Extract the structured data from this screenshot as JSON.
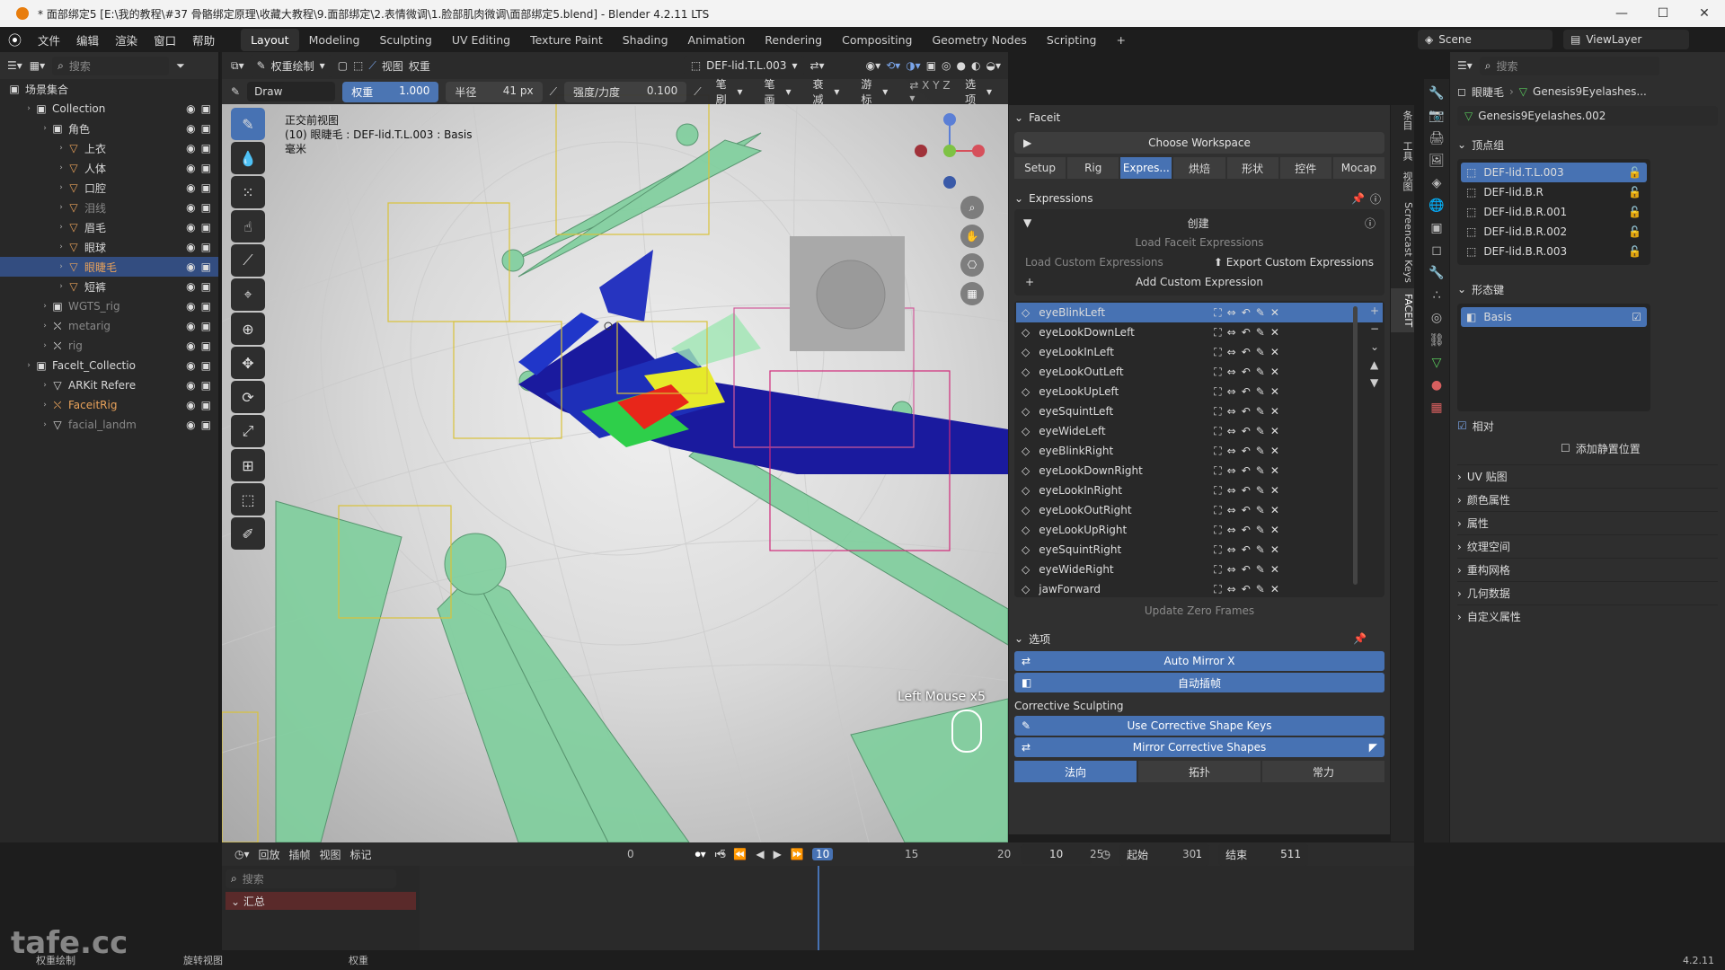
{
  "titlebar": {
    "title": "* 面部绑定5 [E:\\我的教程\\#37 骨骼绑定原理\\收藏大教程\\9.面部绑定\\2.表情微调\\1.脸部肌肉微调\\面部绑定5.blend] - Blender 4.2.11 LTS"
  },
  "menu": [
    "文件",
    "编辑",
    "渲染",
    "窗口",
    "帮助"
  ],
  "workspaces": [
    "Layout",
    "Modeling",
    "Sculpting",
    "UV Editing",
    "Texture Paint",
    "Shading",
    "Animation",
    "Rendering",
    "Compositing",
    "Geometry Nodes",
    "Scripting"
  ],
  "scene": "Scene",
  "viewlayer": "ViewLayer",
  "outliner": {
    "search_placeholder": "搜索",
    "root": "场景集合",
    "rows": [
      {
        "label": "Collection",
        "indent": 1,
        "icon": "▣"
      },
      {
        "label": "角色",
        "indent": 2,
        "icon": "▣"
      },
      {
        "label": "上衣",
        "indent": 3,
        "icon": "▽",
        "orange": true
      },
      {
        "label": "人体",
        "indent": 3,
        "icon": "▽",
        "orange": true
      },
      {
        "label": "口腔",
        "indent": 3,
        "icon": "▽",
        "orange": true
      },
      {
        "label": "泪线",
        "indent": 3,
        "icon": "▽",
        "orange": true,
        "dim": true
      },
      {
        "label": "眉毛",
        "indent": 3,
        "icon": "▽",
        "orange": true
      },
      {
        "label": "眼球",
        "indent": 3,
        "icon": "▽",
        "orange": true
      },
      {
        "label": "眼睫毛",
        "indent": 3,
        "icon": "▽",
        "orange": true,
        "sel": true
      },
      {
        "label": "短裤",
        "indent": 3,
        "icon": "▽",
        "orange": true
      },
      {
        "label": "WGTS_rig",
        "indent": 2,
        "icon": "▣",
        "dim": true
      },
      {
        "label": "metarig",
        "indent": 2,
        "icon": "⛌",
        "dim": true
      },
      {
        "label": "rig",
        "indent": 2,
        "icon": "⛌",
        "dim": true
      },
      {
        "label": "Facelt_Collectio",
        "indent": 1,
        "icon": "▣"
      },
      {
        "label": "ARKit Refere",
        "indent": 2,
        "icon": "▽"
      },
      {
        "label": "FaceitRig",
        "indent": 2,
        "icon": "⛌",
        "orange": true
      },
      {
        "label": "facial_landm",
        "indent": 2,
        "icon": "▽",
        "dim": true
      }
    ]
  },
  "viewport": {
    "mode": "权重绘制",
    "view": "视图",
    "weights": "权重",
    "vgroup": "DEF-lid.T.L.003",
    "brush": "Draw",
    "weight_label": "权重",
    "weight_value": "1.000",
    "radius_label": "半径",
    "radius_value": "41 px",
    "strength_label": "强度/力度",
    "strength_value": "0.100",
    "brush_menu": "笔刷",
    "stroke_menu": "笔画",
    "falloff_menu": "衰减",
    "cursor_menu": "游标",
    "options_menu": "选项",
    "info_line1": "正交前视图",
    "info_line2": "(10) 眼睫毛 : DEF-lid.T.L.003 : Basis",
    "info_line3": "毫米",
    "screencast": "Left Mouse x5"
  },
  "faceit": {
    "panel_title": "Faceit",
    "choose_ws": "Choose Workspace",
    "tabs": [
      "Setup",
      "Rig",
      "Expres...",
      "烘焙",
      "形状",
      "控件",
      "Mocap"
    ],
    "expressions_title": "Expressions",
    "create": "创建",
    "load_faceit": "Load Faceit Expressions",
    "load_custom": "Load Custom Expressions",
    "export_custom": "Export Custom Expressions",
    "add_custom": "Add Custom Expression",
    "expressions": [
      "eyeBlinkLeft",
      "eyeLookDownLeft",
      "eyeLookInLeft",
      "eyeLookOutLeft",
      "eyeLookUpLeft",
      "eyeSquintLeft",
      "eyeWideLeft",
      "eyeBlinkRight",
      "eyeLookDownRight",
      "eyeLookInRight",
      "eyeLookOutRight",
      "eyeLookUpRight",
      "eyeSquintRight",
      "eyeWideRight",
      "jawForward"
    ],
    "update_zero": "Update Zero Frames",
    "options_title": "选项",
    "auto_mirror": "Auto Mirror X",
    "auto_key": "自动插帧",
    "corrective_title": "Corrective Sculpting",
    "use_corrective": "Use Corrective Shape Keys",
    "mirror_corrective": "Mirror Corrective Shapes",
    "axis_tabs": [
      "法向",
      "拓扑",
      "常力"
    ]
  },
  "vtabs": [
    "条目",
    "工具",
    "视图",
    "Screencast Keys",
    "FACEIT"
  ],
  "properties": {
    "search_placeholder": "搜索",
    "obj": "眼睫毛",
    "mesh": "Genesis9Eyelashes...",
    "mesh_field": "Genesis9Eyelashes.002",
    "vgroups_title": "顶点组",
    "vgroups": [
      "DEF-lid.T.L.003",
      "DEF-lid.B.R",
      "DEF-lid.B.R.001",
      "DEF-lid.B.R.002",
      "DEF-lid.B.R.003"
    ],
    "shapekeys_title": "形态键",
    "shapekey": "Basis",
    "relative": "相对",
    "add_rest": "添加静置位置",
    "sections": [
      "UV 贴图",
      "颜色属性",
      "属性",
      "纹理空间",
      "重构网格",
      "几何数据",
      "自定义属性"
    ]
  },
  "timeline": {
    "menus": [
      "回放",
      "插帧",
      "视图",
      "标记"
    ],
    "search_placeholder": "搜索",
    "summary": "汇总",
    "current": "10",
    "start_label": "起始",
    "start": "1",
    "end_label": "结束",
    "end": "511",
    "ticks": [
      "0",
      "5",
      "10",
      "15",
      "20",
      "25",
      "30"
    ]
  },
  "status": {
    "left": "权重绘制",
    "mid": "旋转视图",
    "right": "权重",
    "version": "4.2.11"
  },
  "watermark": "tafe.cc"
}
